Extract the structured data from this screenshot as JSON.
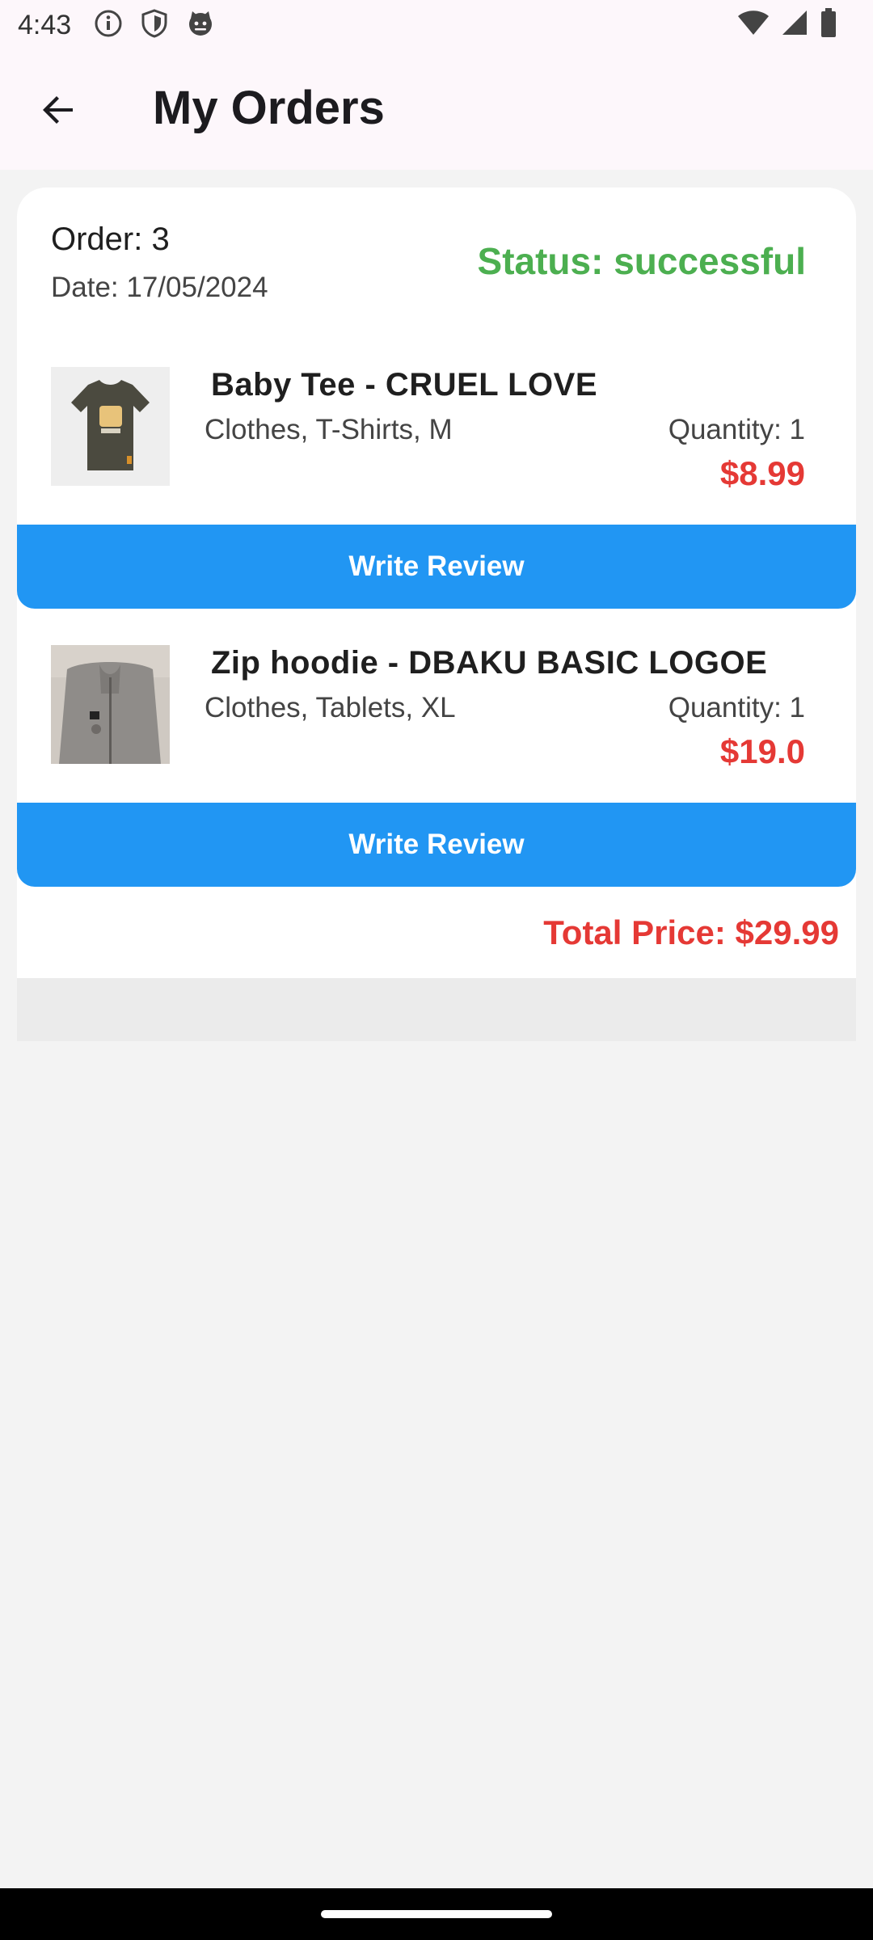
{
  "status_bar": {
    "time": "4:43",
    "icons_left": [
      "info-icon",
      "shield-icon",
      "cat-face-icon"
    ],
    "icons_right": [
      "wifi-icon",
      "signal-icon",
      "battery-icon"
    ]
  },
  "app_bar": {
    "back_icon": "arrow-left-icon",
    "title": "My Orders"
  },
  "order": {
    "order_label": "Order: 3",
    "date_label": "Date: 17/05/2024",
    "status_label": "Status: successful",
    "status_color": "#4caf50",
    "items": [
      {
        "name": " Baby Tee - CRUEL LOVE",
        "categories": "Clothes, T-Shirts, M",
        "quantity": "Quantity: 1",
        "price": "$8.99",
        "review_label": "Write Review"
      },
      {
        "name": " Zip hoodie - DBAKU BASIC LOGOE",
        "categories": "Clothes, Tablets, XL",
        "quantity": "Quantity: 1",
        "price": "$19.0",
        "review_label": "Write Review"
      }
    ],
    "total_label": "Total Price: $29.99"
  },
  "colors": {
    "accent_blue": "#2196f3",
    "price_red": "#e53935",
    "status_green": "#4caf50"
  }
}
